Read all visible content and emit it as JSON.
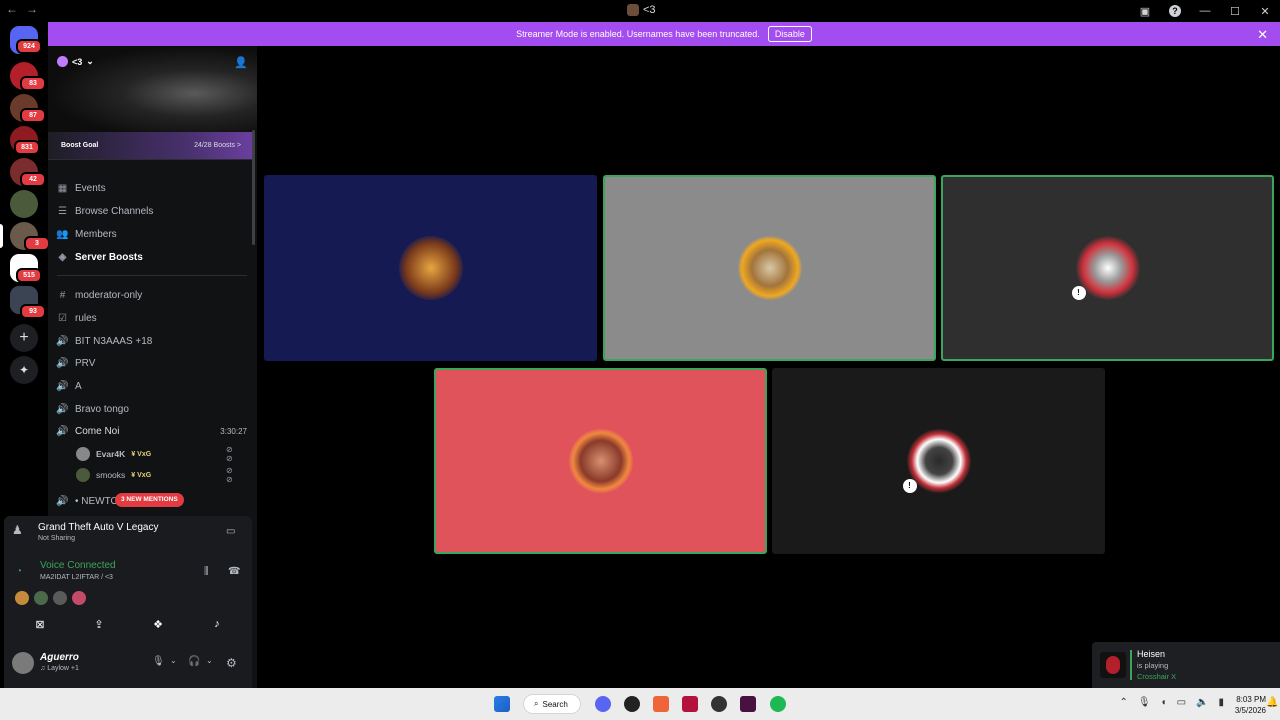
{
  "titlebar": {
    "title": "<3",
    "back": "←",
    "forward": "→",
    "help": "?",
    "minimize": "—",
    "maximize": "☐",
    "close": "✕"
  },
  "rail": {
    "badges": [
      "924",
      "83",
      "87",
      "831",
      "42",
      "3",
      "515",
      "93"
    ],
    "add": "+",
    "explore": "✦"
  },
  "streamer": {
    "message": "Streamer Mode is enabled. Usernames have been truncated.",
    "disable_label": "Disable",
    "close": "✕"
  },
  "server": {
    "name": "<3",
    "chevron": "⌄",
    "invite": "👤"
  },
  "boost": {
    "label": "Boost Goal",
    "progress": "24/28 Boosts",
    "arrow": ">"
  },
  "nav": [
    {
      "label": "Events",
      "icon": "calendar-icon"
    },
    {
      "label": "Browse Channels",
      "icon": "list-icon"
    },
    {
      "label": "Members",
      "icon": "members-icon"
    },
    {
      "label": "Server Boosts",
      "icon": "boost-icon"
    }
  ],
  "channels": [
    {
      "label": "moderator-only",
      "icon": "hash-icon"
    },
    {
      "label": "rules",
      "icon": "rules-icon"
    },
    {
      "label": "BIT N3AAAS +18",
      "icon": "speaker-icon"
    },
    {
      "label": "PRV",
      "icon": "speaker-icon"
    },
    {
      "label": "A",
      "icon": "speaker-icon"
    },
    {
      "label": "Bravo tongo",
      "icon": "speaker-icon"
    },
    {
      "label": "Come Noi",
      "icon": "speaker-icon"
    }
  ],
  "voice_time": "3:30:27",
  "voice_users": [
    {
      "name": "Evar4K",
      "tag": "VxG"
    },
    {
      "name": "smooks",
      "tag": "VxG"
    }
  ],
  "partial_channel": "• NEWTO",
  "mentions": "3 NEW MENTIONS",
  "activity": {
    "game": "Grand Theft Auto V Legacy",
    "status": "Not Sharing"
  },
  "voice": {
    "status": "Voice Connected",
    "channel": "MA2IDAT L2IFTAR / <3"
  },
  "user": {
    "name": "Aguerro",
    "status": "♫ Laylow +1"
  },
  "toast": {
    "name": "Heisen",
    "action": "is playing",
    "game": "Crosshair X"
  },
  "taskbar": {
    "search": "Search",
    "time": "8:03 PM",
    "date": "3/5/2026"
  },
  "colors": {
    "streamer_banner": "#a34cf0",
    "speaking": "#3ba55c",
    "tile_blue": "#151a52",
    "tile_gray": "#8b8b8c",
    "tile_dark": "#2f2f2f",
    "tile_red": "#e0535b",
    "tile_black": "#1a1a1a"
  }
}
